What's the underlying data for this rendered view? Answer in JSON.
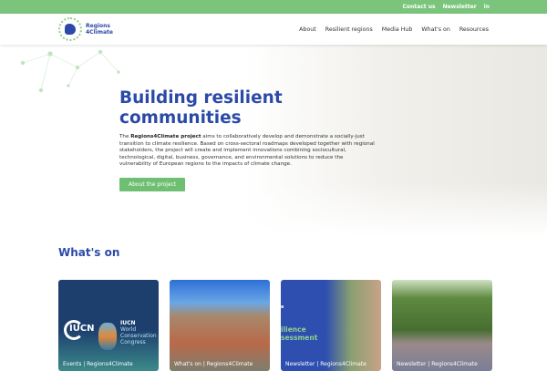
{
  "topbar": {
    "contact": "Contact us",
    "newsletter": "Newsletter",
    "linkedin": "in"
  },
  "logo": {
    "line1": "Regions",
    "line2": "4Climate"
  },
  "nav": [
    "About",
    "Resilient regions",
    "Media Hub",
    "What's on",
    "Resources"
  ],
  "hero": {
    "title": "Building resilient communities",
    "desc_bold": "Regions4Climate project",
    "desc_pre": "The ",
    "desc_rest": " aims to collaboratively develop and demonstrate a socially-just transition to climate resilience. Based on cross-sectoral roadmaps developed together with regional stakeholders, the project will create and implement innovations combining sociocultural, technological, digital, business, governance, and environmental solutions to reduce the vulnerability of European regions to the impacts of climate change.",
    "button": "About the project"
  },
  "whatson": {
    "title": "What's on",
    "cards": [
      {
        "label": "Events | Regions4Climate",
        "logo": "IUCN",
        "t1": "IUCN",
        "t2": "World",
        "t3": "Conservation",
        "t4": "Congress"
      },
      {
        "label": "What's on | Regions4Climate"
      },
      {
        "label": "Newsletter | Regions4Climate",
        "t0": "e",
        "t1": "ilience",
        "t2": "sessment"
      },
      {
        "label": "Newsletter | Regions4Climate"
      }
    ]
  }
}
